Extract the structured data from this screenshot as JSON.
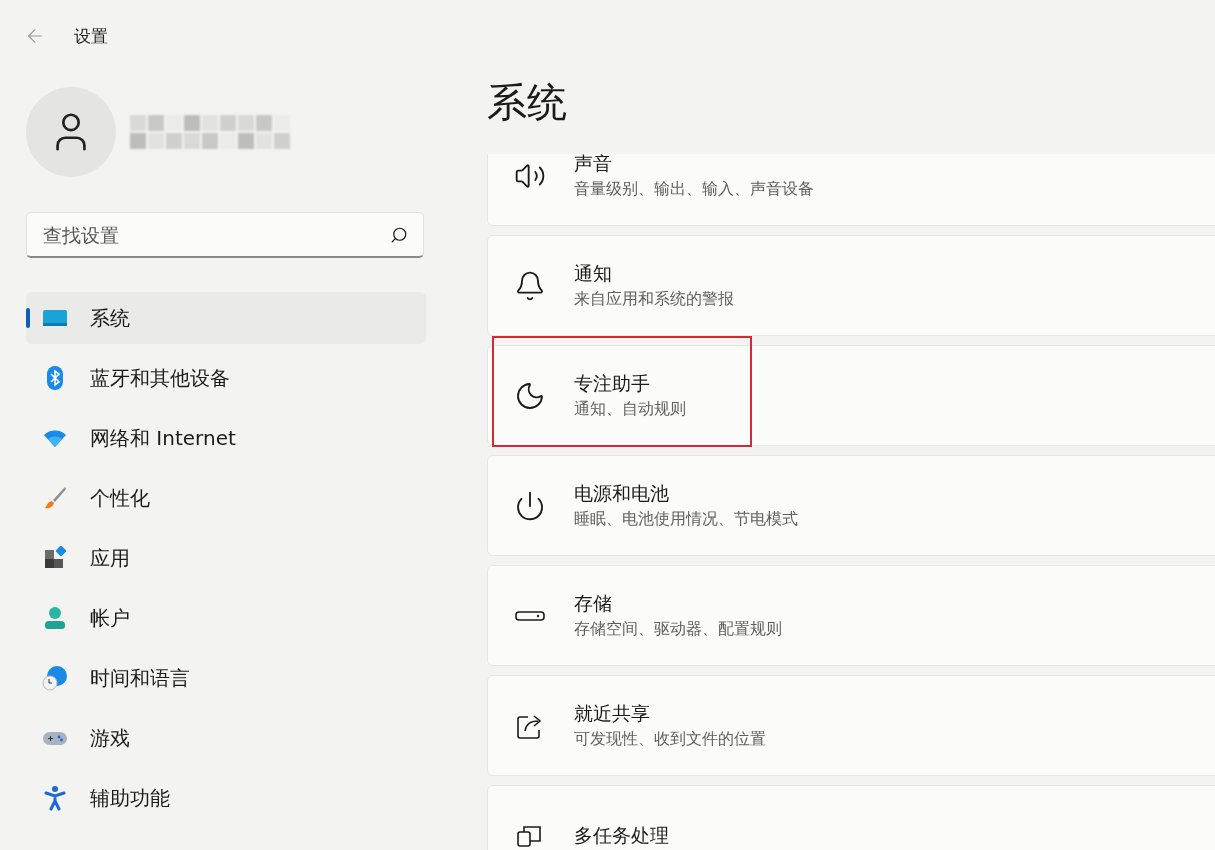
{
  "header": {
    "title": "设置"
  },
  "search": {
    "placeholder": "查找设置"
  },
  "nav": [
    {
      "label": "系统",
      "kind": "system",
      "selected": true
    },
    {
      "label": "蓝牙和其他设备",
      "kind": "bluetooth",
      "selected": false
    },
    {
      "label": "网络和 Internet",
      "kind": "network",
      "selected": false
    },
    {
      "label": "个性化",
      "kind": "personalization",
      "selected": false
    },
    {
      "label": "应用",
      "kind": "apps",
      "selected": false
    },
    {
      "label": "帐户",
      "kind": "accounts",
      "selected": false
    },
    {
      "label": "时间和语言",
      "kind": "time",
      "selected": false
    },
    {
      "label": "游戏",
      "kind": "gaming",
      "selected": false
    },
    {
      "label": "辅助功能",
      "kind": "accessibility",
      "selected": false
    }
  ],
  "page_title": "系统",
  "settings": [
    {
      "title": "声音",
      "subtitle": "音量级别、输出、输入、声音设备",
      "kind": "sound",
      "highlighted": false
    },
    {
      "title": "通知",
      "subtitle": "来自应用和系统的警报",
      "kind": "notifications",
      "highlighted": false
    },
    {
      "title": "专注助手",
      "subtitle": "通知、自动规则",
      "kind": "focus",
      "highlighted": true
    },
    {
      "title": "电源和电池",
      "subtitle": "睡眠、电池使用情况、节电模式",
      "kind": "power",
      "highlighted": false
    },
    {
      "title": "存储",
      "subtitle": "存储空间、驱动器、配置规则",
      "kind": "storage",
      "highlighted": false
    },
    {
      "title": "就近共享",
      "subtitle": "可发现性、收到文件的位置",
      "kind": "sharing",
      "highlighted": false
    },
    {
      "title": "多任务处理",
      "kind": "multitasking",
      "highlighted": false
    }
  ]
}
